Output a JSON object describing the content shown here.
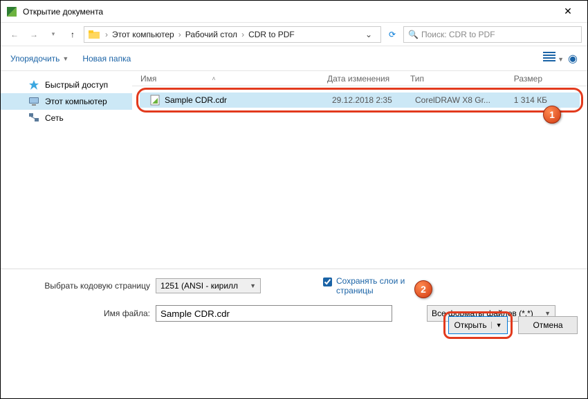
{
  "window": {
    "title": "Открытие документа"
  },
  "breadcrumb": {
    "p1": "Этот компьютер",
    "p2": "Рабочий стол",
    "p3": "CDR to PDF"
  },
  "search": {
    "placeholder": "Поиск: CDR to PDF"
  },
  "toolbar": {
    "organize": "Упорядочить",
    "newfolder": "Новая папка"
  },
  "sidebar": {
    "items": [
      {
        "label": "Быстрый доступ"
      },
      {
        "label": "Этот компьютер"
      },
      {
        "label": "Сеть"
      }
    ]
  },
  "columns": {
    "name": "Имя",
    "date": "Дата изменения",
    "type": "Тип",
    "size": "Размер"
  },
  "files": [
    {
      "name": "Sample CDR.cdr",
      "date": "29.12.2018 2:35",
      "type": "CorelDRAW X8 Gr...",
      "size": "1 314 КБ"
    }
  ],
  "footer": {
    "codepage_label": "Выбрать кодовую страницу",
    "codepage_value": "1251  (ANSI - кирилл",
    "preserve_layers": "Сохранять слои и страницы",
    "filename_label": "Имя файла:",
    "filename_value": "Sample CDR.cdr",
    "filetype": "Все форматы файлов (*.*)",
    "open": "Открыть",
    "cancel": "Отмена"
  },
  "callouts": {
    "one": "1",
    "two": "2"
  }
}
